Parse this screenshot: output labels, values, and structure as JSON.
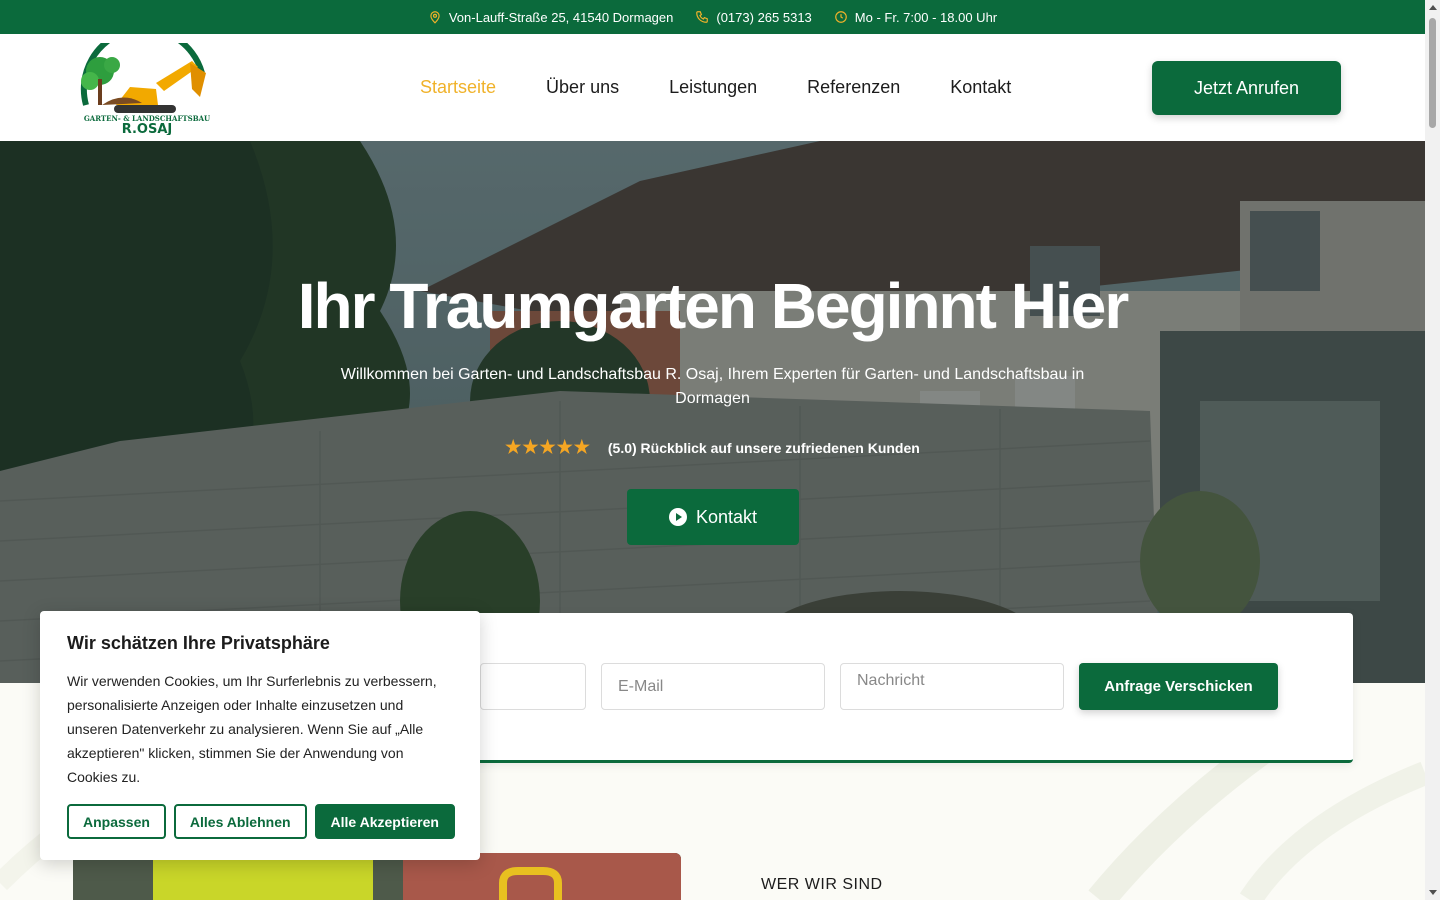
{
  "topbar": {
    "address": "Von-Lauff-Straße 25, 41540 Dormagen",
    "phone": "(0173) 265 5313",
    "hours": "Mo - Fr. 7:00 - 18.00 Uhr"
  },
  "header": {
    "logo_text": "R.OSAJ",
    "logo_subtext": "GARTEN- & LANDSCHAFTSBAU",
    "nav": [
      {
        "label": "Startseite",
        "active": true
      },
      {
        "label": "Über uns"
      },
      {
        "label": "Leistungen"
      },
      {
        "label": "Referenzen"
      },
      {
        "label": "Kontakt"
      }
    ],
    "cta_label": "Jetzt Anrufen"
  },
  "hero": {
    "title": "Ihr Traumgarten Beginnt Hier",
    "subtitle": "Willkommen bei Garten- und Landschaftsbau R. Osaj, Ihrem Experten für Garten- und Landschaftsbau in Dormagen",
    "rating_text": "(5.0) Rückblick auf unsere zufriedenen Kunden",
    "rating_value": 5,
    "button_label": "Kontakt"
  },
  "form": {
    "email_placeholder": "E-Mail",
    "message_placeholder": "Nachricht",
    "submit_label": "Anfrage Verschicken"
  },
  "about": {
    "label": "WER WIR SIND"
  },
  "cookie": {
    "title": "Wir schätzen Ihre Privatsphäre",
    "body": "Wir verwenden Cookies, um Ihr Surferlebnis zu verbessern, personalisierte Anzeigen oder Inhalte einzusetzen und unseren Datenverkehr zu analysieren. Wenn Sie auf „Alle akzeptieren\" klicken, stimmen Sie der Anwendung von Cookies zu.",
    "customize_label": "Anpassen",
    "reject_label": "Alles Ablehnen",
    "accept_label": "Alle Akzeptieren"
  },
  "colors": {
    "brand_green": "#0b6a3c",
    "accent_yellow": "#f0b22a",
    "star": "#f5a623"
  }
}
